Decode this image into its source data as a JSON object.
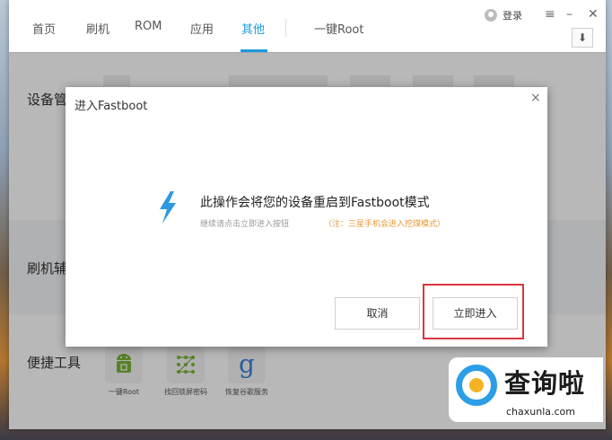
{
  "nav": {
    "tabs": [
      "首页",
      "刷机",
      "ROM",
      "应用",
      "其他"
    ],
    "one_key_root": "一键Root",
    "login": "登录",
    "menu_icon": "≡",
    "minimize_icon": "–",
    "close_icon": "✕",
    "download_icon": "⬇"
  },
  "sections": {
    "device": "设备管",
    "flash_helper": "刷机辅",
    "tools": "便捷工具"
  },
  "tools": [
    {
      "label": "一键Root",
      "icon": "android-icon"
    },
    {
      "label": "找回锁屏密码",
      "icon": "pattern-lock-icon"
    },
    {
      "label": "恢复谷歌服务",
      "icon": "google-icon"
    }
  ],
  "dialog": {
    "title": "进入Fastboot",
    "close": "×",
    "message": "此操作会将您的设备重启到Fastboot模式",
    "sub": "继续请点击立即进入按钮",
    "note": "（注：三星手机会进入挖煤模式）",
    "cancel": "取消",
    "confirm": "立即进入"
  },
  "watermark": {
    "text": "查询啦",
    "url": "chaxunla.com"
  },
  "colors": {
    "accent": "#1a9ae0",
    "bolt": "#2e98e0",
    "note": "#e89a3a",
    "highlight": "#d9363e"
  }
}
